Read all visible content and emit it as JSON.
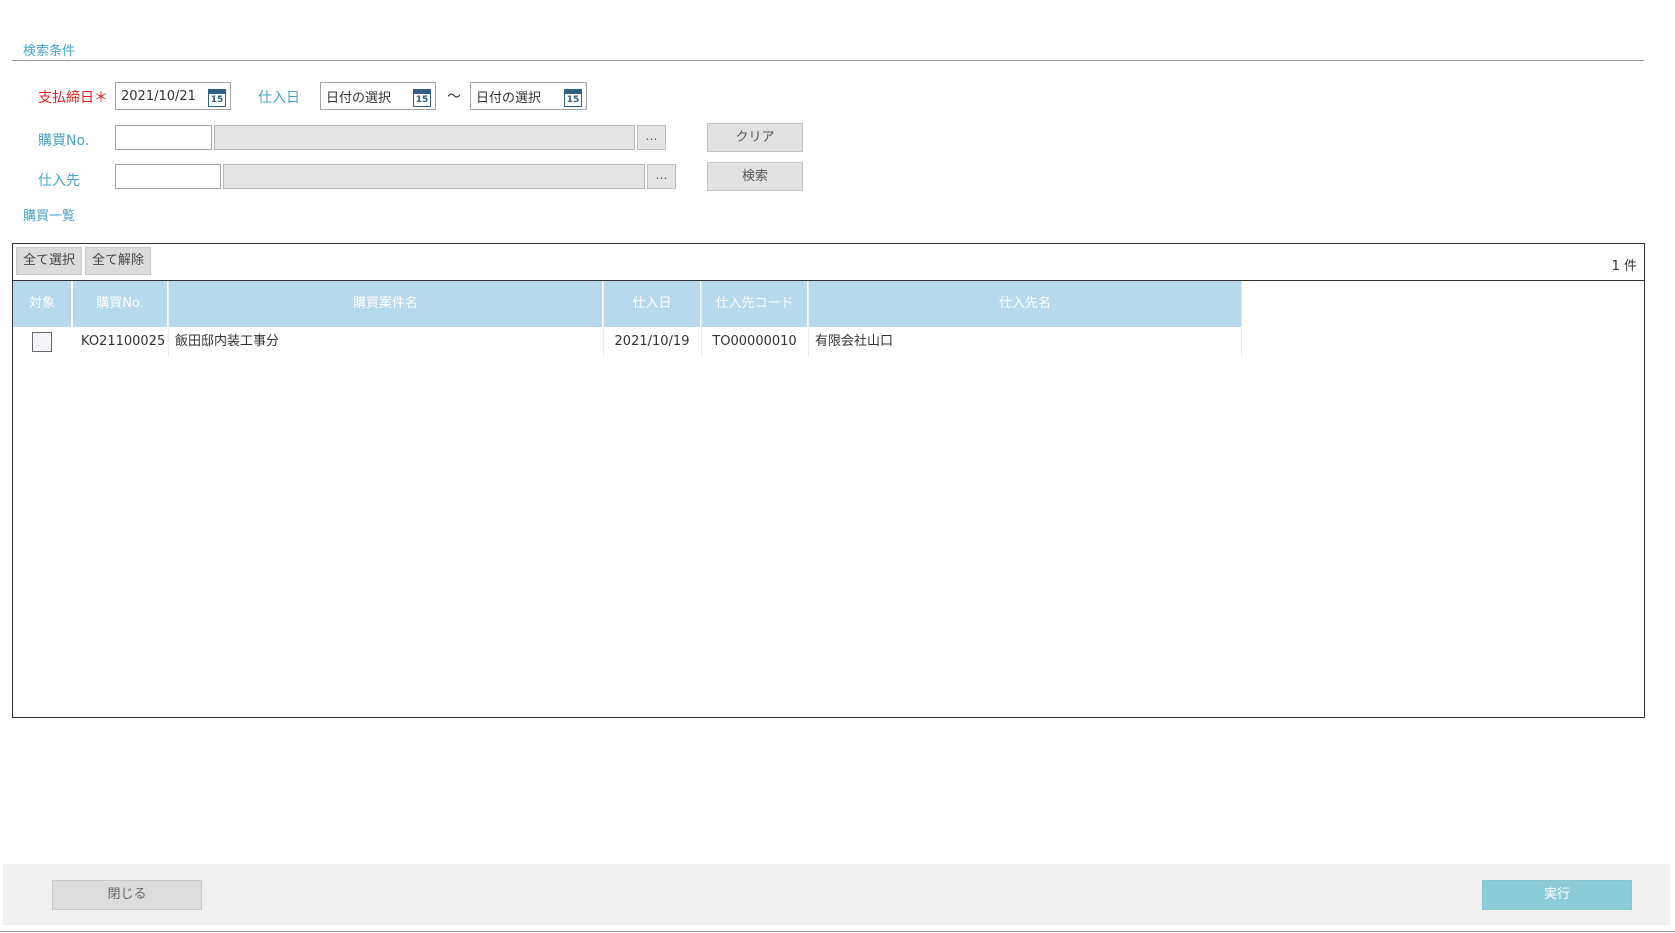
{
  "search": {
    "section_title": "検索条件",
    "payment_close_date": {
      "label": "支払締日",
      "required_mark": "＊",
      "value": "2021/10/21"
    },
    "purchase_date": {
      "label": "仕入日",
      "from_placeholder": "日付の選択",
      "separator": "〜",
      "to_placeholder": "日付の選択"
    },
    "purchase_no": {
      "label": "購買No.",
      "code_value": "",
      "name_value": "",
      "lookup_label": "…"
    },
    "supplier": {
      "label": "仕入先",
      "code_value": "",
      "name_value": "",
      "lookup_label": "…"
    },
    "calendar_icon_text": "15",
    "clear_label": "クリア",
    "search_label": "検索"
  },
  "list": {
    "section_title": "購買一覧",
    "select_all_label": "全て選択",
    "deselect_all_label": "全て解除",
    "count_text": "1 件",
    "columns": [
      "対象",
      "購買No.",
      "購買案件名",
      "仕入日",
      "仕入先コード",
      "仕入先名"
    ],
    "rows": [
      {
        "checked": false,
        "purchase_no": "KO21100025",
        "project_name": "飯田邸内装工事分",
        "purchase_date": "2021/10/19",
        "supplier_code": "TO00000010",
        "supplier_name": "有限会社山口"
      }
    ]
  },
  "footer": {
    "close_label": "閉じる",
    "execute_label": "実行"
  },
  "colors": {
    "accent_label": "#4aa3c4",
    "required_label": "#e02020",
    "header_bg": "#b6d9ee",
    "execute_bg": "#8ccbd8"
  }
}
